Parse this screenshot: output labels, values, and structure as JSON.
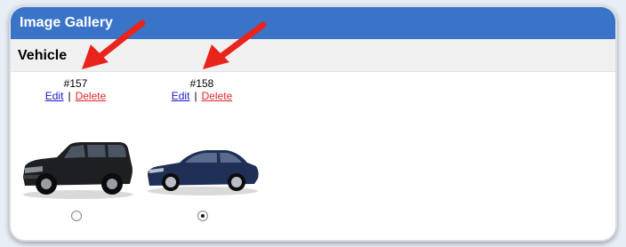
{
  "panel": {
    "title": "Image Gallery"
  },
  "section": {
    "title": "Vehicle"
  },
  "items": [
    {
      "id_label": "#157",
      "edit_label": "Edit",
      "separator": "|",
      "delete_label": "Delete",
      "image": "black-suv",
      "selected": false
    },
    {
      "id_label": "#158",
      "edit_label": "Edit",
      "separator": "|",
      "delete_label": "Delete",
      "image": "blue-coupe",
      "selected": true
    }
  ],
  "colors": {
    "titlebar": "#3a74c8",
    "link": "#1a1acd",
    "delete_link": "#e0272d",
    "annotation_arrow": "#e8241c"
  }
}
